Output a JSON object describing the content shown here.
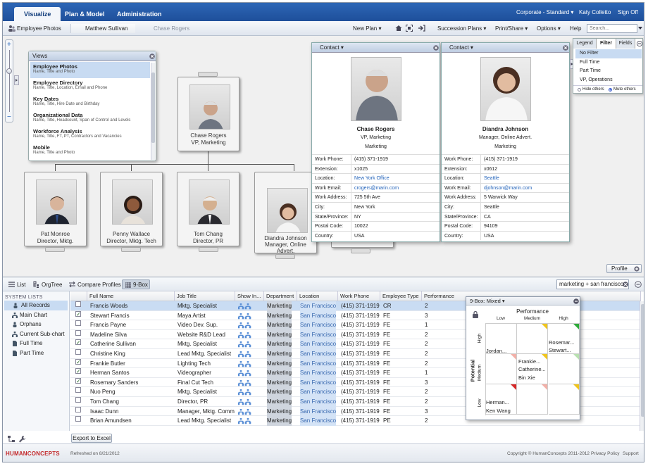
{
  "nav": {
    "tabs": [
      "Visualize",
      "Plan & Model",
      "Administration"
    ],
    "scope": "Corporate - Standard",
    "scope_arrow": "▾",
    "user": "Katy Colletto",
    "signoff": "Sign Off"
  },
  "toolbar": {
    "view": "Employee Photos",
    "crumbs": [
      "Matthew Sullivan",
      "Chase Rogers"
    ],
    "new_plan": "New Plan",
    "succession": "Succession Plans",
    "print": "Print/Share",
    "options": "Options",
    "help": "Help",
    "search_placeholder": "Search...",
    "dropdown_arrow": "▾"
  },
  "views_panel": {
    "title": "Views",
    "items": [
      {
        "title": "Employee Photos",
        "sub": "Name, Title and Photo"
      },
      {
        "title": "Employee Directory",
        "sub": "Name, Title, Location, Email and Phone"
      },
      {
        "title": "Key Dates",
        "sub": "Name, Title, Hire Date and Birthday"
      },
      {
        "title": "Organizational Data",
        "sub": "Name, Title, Headcount, Span of Control and Levels"
      },
      {
        "title": "Workforce Analysis",
        "sub": "Name, Title, FT, PT, Contractors and Vacancies"
      },
      {
        "title": "Mobile",
        "sub": "Name, Title and Photo"
      }
    ]
  },
  "org": {
    "top": {
      "name": "Chase Rogers",
      "title": "VP, Marketing"
    },
    "reports": [
      {
        "name": "Pat Monroe",
        "title": "Director, Mktg."
      },
      {
        "name": "Penny Wallace",
        "title": "Director, Mktg. Tech"
      },
      {
        "name": "Tom Chang",
        "title": "Director, PR"
      },
      {
        "name": "Diandra Johnson",
        "title": "Manager, Online",
        "title2": "Advert."
      }
    ]
  },
  "contacts": [
    {
      "header": "Contact",
      "name": "Chase Rogers",
      "title": "VP, Marketing",
      "dept": "Marketing",
      "rows": [
        {
          "k": "Work Phone:",
          "v": "(415) 371-1919"
        },
        {
          "k": "Extension:",
          "v": "x1025"
        },
        {
          "k": "Location:",
          "v": "New York Office"
        },
        {
          "k": "Work Email:",
          "v": "crogers@marin.com"
        },
        {
          "k": "Work Address:",
          "v": "725 5th Ave"
        },
        {
          "k": "City:",
          "v": "New York"
        },
        {
          "k": "State/Province:",
          "v": "NY"
        },
        {
          "k": "Postal Code:",
          "v": "10022"
        },
        {
          "k": "Country:",
          "v": "USA"
        }
      ]
    },
    {
      "header": "Contact",
      "name": "Diandra Johnson",
      "title": "Manager, Online Advert.",
      "dept": "Marketing",
      "rows": [
        {
          "k": "Work Phone:",
          "v": "(415) 371-1919"
        },
        {
          "k": "Extension:",
          "v": "x0612"
        },
        {
          "k": "Location:",
          "v": "Seattle"
        },
        {
          "k": "Work Email:",
          "v": "djohnson@marin.com"
        },
        {
          "k": "Work Address:",
          "v": "5 Warwick Way"
        },
        {
          "k": "City:",
          "v": "Seattle"
        },
        {
          "k": "State/Province:",
          "v": "CA"
        },
        {
          "k": "Postal Code:",
          "v": "94109"
        },
        {
          "k": "Country:",
          "v": "USA"
        }
      ]
    }
  ],
  "filter_panel": {
    "tabs": [
      "Legend",
      "Filter",
      "Fields"
    ],
    "items": [
      "No Filter",
      "Full Time",
      "Part Time",
      "VP, Operations"
    ],
    "hide": "Hide others",
    "mute": "Mute others"
  },
  "profile_btn": "Profile",
  "lower_toolbar": {
    "list": "List",
    "orgtree": "OrgTree",
    "compare": "Compare Profiles",
    "ninebox": "9-Box",
    "search_value": "marketing + san francisco"
  },
  "system_lists": {
    "title": "SYSTEM LISTS",
    "items": [
      "All Records",
      "Main Chart",
      "Orphans",
      "Current Sub-chart",
      "Full Time",
      "Part Time"
    ]
  },
  "grid": {
    "columns": [
      "Full Name",
      "Job Title",
      "Show In...",
      "Department",
      "Location",
      "Work Phone",
      "Employee Type",
      "Performance"
    ],
    "rows": [
      {
        "checked": false,
        "name": "Francis Woods",
        "title": "Mktg. Specialist",
        "dept": "Marketing",
        "loc": "San Francisco",
        "phone": "(415) 371-1919",
        "type": "CR",
        "perf": "2"
      },
      {
        "checked": true,
        "name": "Stewart Francis",
        "title": "Maya Artist",
        "dept": "Marketing",
        "loc": "San Francisco",
        "phone": "(415) 371-1919",
        "type": "FE",
        "perf": "3"
      },
      {
        "checked": false,
        "name": "Francis Payne",
        "title": "Video Dev. Sup.",
        "dept": "Marketing",
        "loc": "San Francisco",
        "phone": "(415) 371-1919",
        "type": "FE",
        "perf": "1"
      },
      {
        "checked": false,
        "name": "Madeline Silva",
        "title": "Website R&D Lead",
        "dept": "Marketing",
        "loc": "San Francisco",
        "phone": "(415) 371-1919",
        "type": "FE",
        "perf": "2"
      },
      {
        "checked": true,
        "name": "Catherine Sullivan",
        "title": "Mktg. Specialist",
        "dept": "Marketing",
        "loc": "San Francisco",
        "phone": "(415) 371-1919",
        "type": "FE",
        "perf": "2"
      },
      {
        "checked": false,
        "name": "Christine King",
        "title": "Lead Mktg. Specialist",
        "dept": "Marketing",
        "loc": "San Francisco",
        "phone": "(415) 371-1919",
        "type": "FE",
        "perf": "2"
      },
      {
        "checked": true,
        "name": "Frankie Butler",
        "title": "Lighting Tech",
        "dept": "Marketing",
        "loc": "San Francisco",
        "phone": "(415) 371-1919",
        "type": "FE",
        "perf": "2"
      },
      {
        "checked": true,
        "name": "Herman Santos",
        "title": "Videographer",
        "dept": "Marketing",
        "loc": "San Francisco",
        "phone": "(415) 371-1919",
        "type": "FE",
        "perf": "1"
      },
      {
        "checked": true,
        "name": "Rosemary Sanders",
        "title": "Final Cut Tech",
        "dept": "Marketing",
        "loc": "San Francisco",
        "phone": "(415) 371-1919",
        "type": "FE",
        "perf": "3"
      },
      {
        "checked": false,
        "name": "Nuo Peng",
        "title": "Mktg. Specialist",
        "dept": "Marketing",
        "loc": "San Francisco",
        "phone": "(415) 371-1919",
        "type": "FE",
        "perf": "2"
      },
      {
        "checked": false,
        "name": "Tom Chang",
        "title": "Director, PR",
        "dept": "Marketing",
        "loc": "San Francisco",
        "phone": "(415) 371-1919",
        "type": "FE",
        "perf": "2"
      },
      {
        "checked": false,
        "name": "Isaac Dunn",
        "title": "Manager, Mktg. Comm",
        "dept": "Marketing",
        "loc": "San Francisco",
        "phone": "(415) 371-1919",
        "type": "FE",
        "perf": "3"
      },
      {
        "checked": false,
        "name": "Brian Amundsen",
        "title": "Lead Mktg. Specialist",
        "dept": "Marketing",
        "loc": "San Francisco",
        "phone": "(415) 371-1919",
        "type": "PE",
        "perf": "2"
      }
    ]
  },
  "ninebox": {
    "header": "9-Box:",
    "mode": "Mixed",
    "perf": "Performance",
    "cols": [
      "Low",
      "Medium",
      "High"
    ],
    "potential": "Potential",
    "rows": [
      "High",
      "Medium",
      "Low"
    ],
    "cells": {
      "hl": [
        "Jordan..."
      ],
      "hh": [
        "Rosemar...",
        "Stewart..."
      ],
      "mm": [
        "Frankie...",
        "Catherine...",
        "Bin Xie"
      ],
      "ll": [
        "Herman...",
        "Ken Wang"
      ]
    }
  },
  "export": "Export to Excel",
  "footer": {
    "brand": "HUMANCONCEPTS",
    "refreshed": "Refreshed on 8/21/2012",
    "copyright": "Copyright © HumanConcepts 2011-2012",
    "privacy": "Privacy Policy",
    "support": "Support"
  }
}
